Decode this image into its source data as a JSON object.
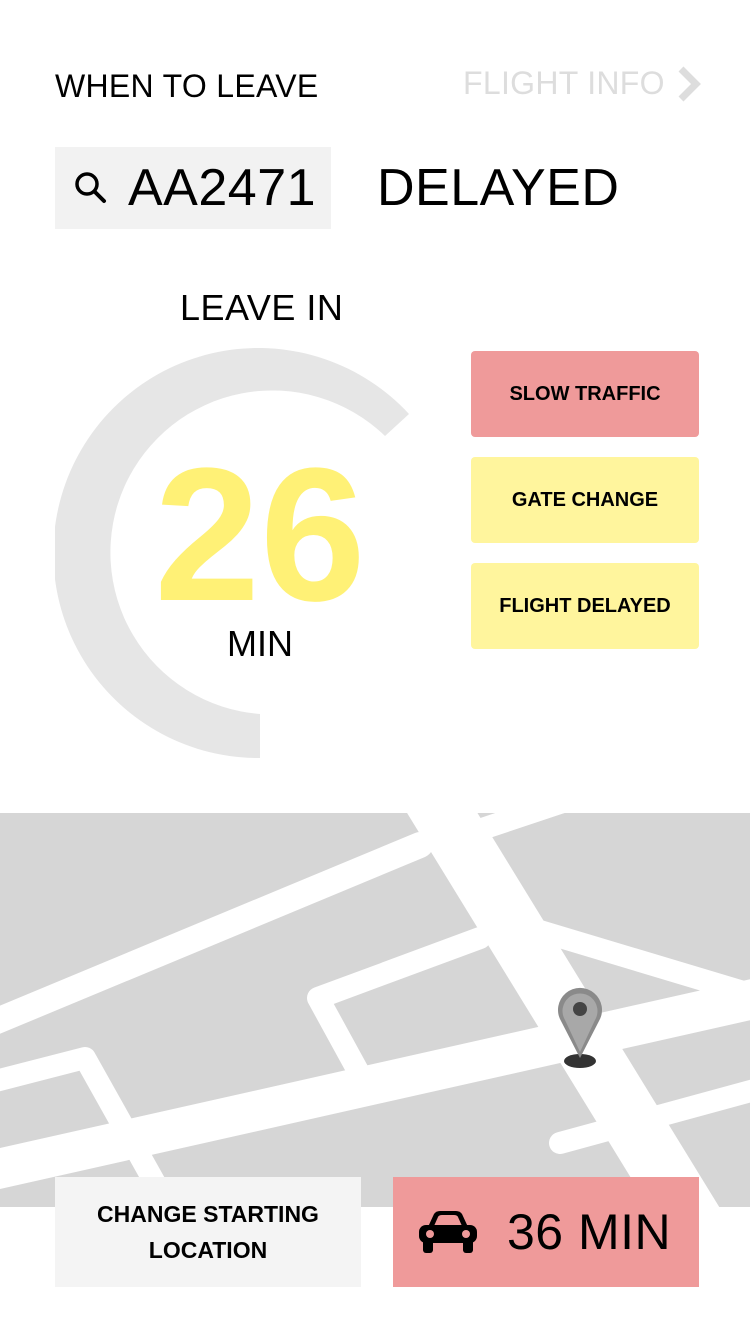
{
  "header": {
    "title": "WHEN TO LEAVE",
    "flight_info_label": "FLIGHT INFO"
  },
  "search": {
    "value": "AA2471",
    "icon": "search-icon"
  },
  "flight_status": "DELAYED",
  "leave": {
    "label": "LEAVE IN",
    "minutes": "26",
    "unit": "MIN"
  },
  "alerts": [
    {
      "label": "SLOW TRAFFIC",
      "color": "#ef9a9a"
    },
    {
      "label": "GATE CHANGE",
      "color": "#fff59d"
    },
    {
      "label": "FLIGHT DELAYED",
      "color": "#fff59d"
    }
  ],
  "actions": {
    "change_start_label": "CHANGE STARTING LOCATION",
    "drive_time_label": "36 MIN",
    "drive_icon": "car-icon",
    "drive_color": "#ef9a9a"
  },
  "colors": {
    "accent_yellow": "#fff176",
    "ring_gray": "#e6e6e6",
    "map_gray": "#d6d6d6",
    "muted_text": "#dddddd"
  }
}
